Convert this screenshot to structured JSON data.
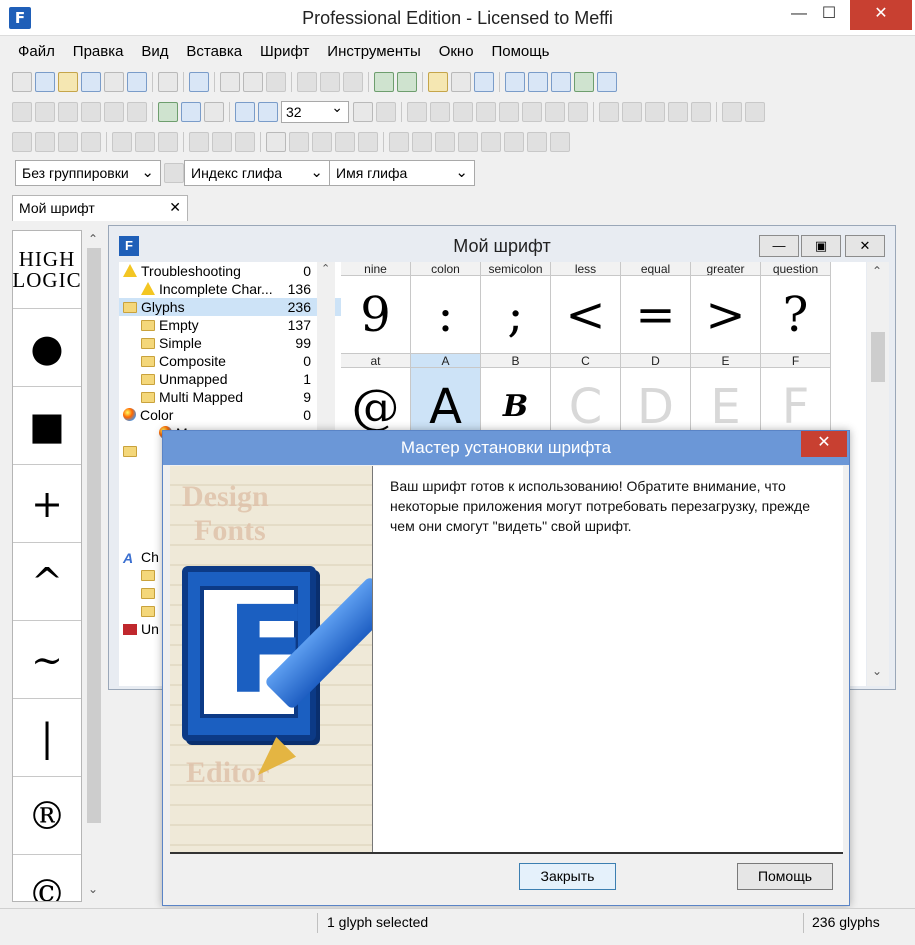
{
  "window": {
    "title": "Professional Edition - Licensed to Meffi"
  },
  "menu": [
    "Файл",
    "Правка",
    "Вид",
    "Вставка",
    "Шрифт",
    "Инструменты",
    "Окно",
    "Помощь"
  ],
  "toolbar": {
    "zoom_value": "32"
  },
  "combos": {
    "grouping": "Без группировки",
    "glyph_index": "Индекс глифа",
    "glyph_name": "Имя глифа"
  },
  "doc_tab": {
    "label": "Мой шрифт"
  },
  "strip": {
    "logo_line1": "HIGH",
    "logo_line2": "LOGIC",
    "glyphs": [
      "●",
      "■",
      "+",
      "^",
      "~",
      "|",
      "®",
      "©"
    ]
  },
  "font_window": {
    "title": "Мой шрифт"
  },
  "tree": {
    "troubleshooting": {
      "label": "Troubleshooting",
      "count": "0"
    },
    "incomplete": {
      "label": "Incomplete Char...",
      "count": "136"
    },
    "glyphs": {
      "label": "Glyphs",
      "count": "236"
    },
    "empty": {
      "label": "Empty",
      "count": "137"
    },
    "simple": {
      "label": "Simple",
      "count": "99"
    },
    "composite": {
      "label": "Composite",
      "count": "0"
    },
    "unmapped": {
      "label": "Unmapped",
      "count": "1"
    },
    "multi_mapped": {
      "label": "Multi Mapped",
      "count": "9"
    },
    "color": {
      "label": "Color",
      "count": "0"
    },
    "partial_m": "M",
    "partial_ch": "Ch",
    "partial_un": "Un"
  },
  "grid": {
    "row1_headers": [
      "nine",
      "colon",
      "semicolon",
      "less",
      "equal",
      "greater",
      "question"
    ],
    "row1_glyphs": [
      "9",
      ":",
      ";",
      "<",
      "=",
      ">",
      "?"
    ],
    "row2_headers": [
      "at",
      "A",
      "B",
      "C",
      "D",
      "E",
      "F"
    ],
    "row2_glyphs": [
      "@",
      "A",
      "B",
      "C",
      "D",
      "E",
      "F"
    ]
  },
  "dialog": {
    "title": "Мастер установки шрифта",
    "message": "Ваш шрифт готов к использованию! Обратите внимание, что некоторые приложения могут потребовать перезагрузку, прежде чем они смогут \"видеть\" свой шрифт.",
    "banner_words": [
      "Design",
      "Fonts",
      "Editor"
    ],
    "close_button": "Закрыть",
    "help_button": "Помощь"
  },
  "status": {
    "selection": "1 glyph selected",
    "total": "236 glyphs"
  },
  "colors": {
    "accent": "#6b97d7",
    "close_red": "#c84031",
    "selection": "#cde3f7"
  }
}
